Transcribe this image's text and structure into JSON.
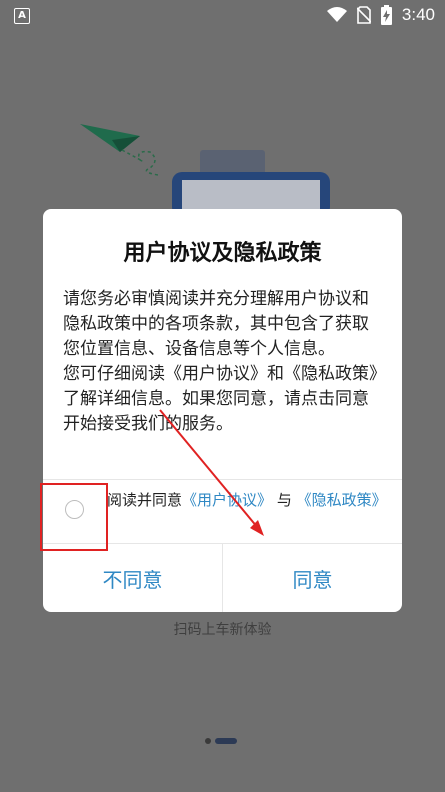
{
  "status_bar": {
    "left_icon": "A",
    "time": "3:40",
    "icons": [
      "wifi-icon",
      "no-sim-icon",
      "battery-charging-icon"
    ]
  },
  "background": {
    "caption": "扫码上车新体验"
  },
  "dialog": {
    "title": "用户协议及隐私政策",
    "paragraph1": "请您务必审慎阅读并充分理解用户协议和隐私政策中的各项条款，其中包含了获取您位置信息、设备信息等个人信息。",
    "paragraph2": "您可仔细阅读《用户协议》和《隐私政策》了解详细信息。如果您同意，请点击同意开始接受我们的服务。",
    "agree_prefix": "阅读并同意",
    "user_agreement_link": "《用户协议》",
    "and": "与",
    "privacy_policy_link": "《隐私政策》",
    "disagree_label": "不同意",
    "agree_label": "同意"
  },
  "colors": {
    "link": "#2f88c4",
    "annotation": "#e02222",
    "overlay": "#6f6f6f"
  }
}
